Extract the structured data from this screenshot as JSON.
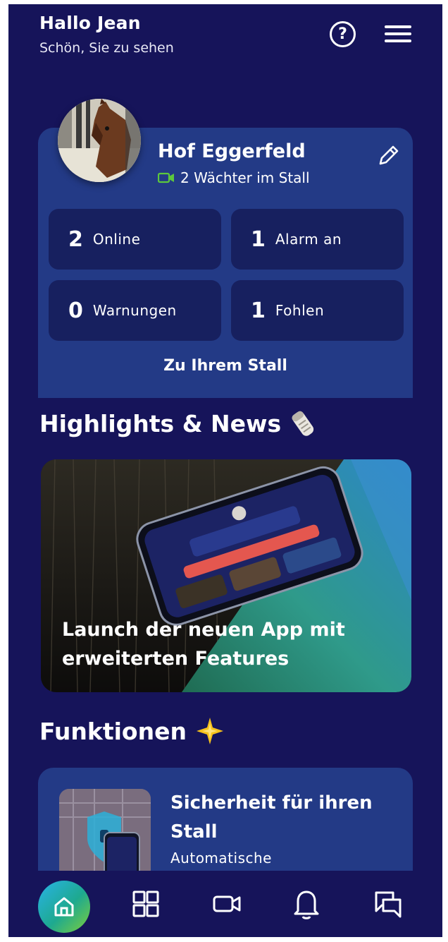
{
  "header": {
    "title": "Hallo Jean",
    "subtitle": "Schön, Sie zu sehen",
    "help_icon": "question-circle-icon",
    "menu_icon": "hamburger-menu-icon"
  },
  "stall": {
    "name": "Hof Eggerfeld",
    "guards_label": "2 Wächter im Stall",
    "avatar": "horse-photo",
    "stats": [
      {
        "value": "2",
        "label": "Online"
      },
      {
        "value": "1",
        "label": "Alarm an"
      },
      {
        "value": "0",
        "label": "Warnungen"
      },
      {
        "value": "1",
        "label": "Fohlen"
      }
    ],
    "link_label": "Zu Ihrem Stall"
  },
  "highlights": {
    "title": "Highlights & News",
    "emoji_icon": "newspaper-roll-icon",
    "card_title": "Launch der neuen App mit erweiterten Features"
  },
  "functions": {
    "title": "Funktionen",
    "emoji_icon": "sparkle-star-icon",
    "card_title": "Sicherheit für ihren Stall",
    "card_subtitle": "Automatische"
  },
  "nav": {
    "items": [
      "home-icon",
      "grid-icon",
      "video-camera-icon",
      "bell-icon",
      "chat-bubbles-icon"
    ]
  },
  "colors": {
    "background": "#16145a",
    "card": "#233a86",
    "stat_tile": "#17205f",
    "accent_green": "#5cc83c"
  }
}
